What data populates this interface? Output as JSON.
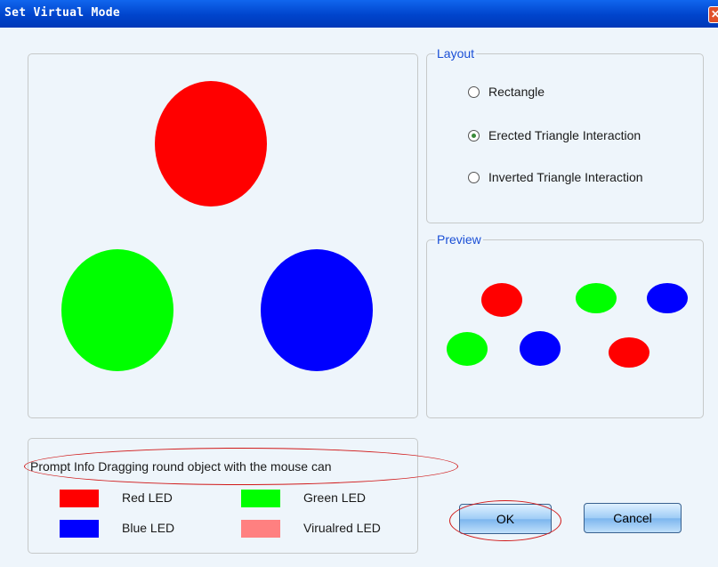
{
  "window": {
    "title": "Set Virtual Mode",
    "close_icon": "close-x-icon"
  },
  "layout": {
    "legend": "Layout",
    "options": [
      {
        "label": "Rectangle",
        "selected": false
      },
      {
        "label": "Erected Triangle Interaction",
        "selected": true
      },
      {
        "label": "Inverted Triangle Interaction",
        "selected": false
      }
    ]
  },
  "preview": {
    "legend": "Preview"
  },
  "prompt": {
    "text": "Prompt Info Dragging round object with the mouse can"
  },
  "led_legend": {
    "items": [
      {
        "label": "Red LED",
        "color": "#ff0000"
      },
      {
        "label": "Green LED",
        "color": "#00ff00"
      },
      {
        "label": "Blue LED",
        "color": "#0000ff"
      },
      {
        "label": "Virualred LED",
        "color": "#ff8080"
      }
    ]
  },
  "buttons": {
    "ok": "OK",
    "cancel": "Cancel"
  },
  "colors": {
    "red": "#ff0000",
    "green": "#00ff00",
    "blue": "#0000ff",
    "virualred": "#ff8080",
    "titlebar": "#0a4fdc"
  }
}
